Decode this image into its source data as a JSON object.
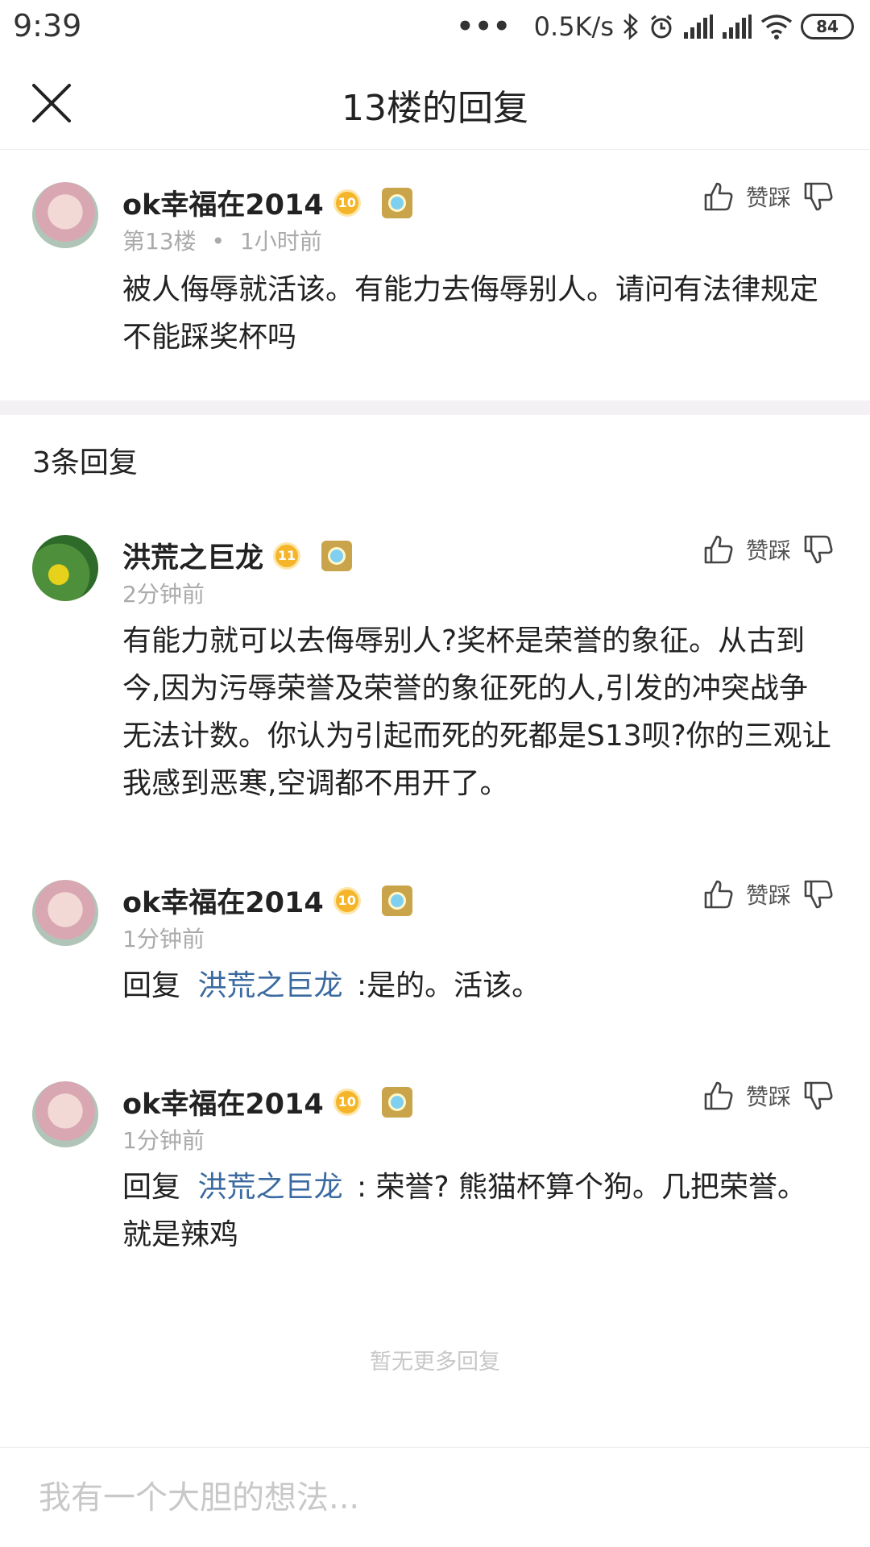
{
  "status_bar": {
    "time": "9:39",
    "dots": "•••",
    "speed": "0.5K/s",
    "battery": "84"
  },
  "header": {
    "title": "13楼的回复"
  },
  "post": {
    "username": "ok幸福在2014",
    "level": "10",
    "floor": "第13楼",
    "separator": "•",
    "time": "1小时前",
    "text": "被人侮辱就活该。有能力去侮辱别人。请问有法律规定不能踩奖杯吗",
    "vote_label": "赞踩"
  },
  "replies_header": {
    "count_label": "3条回复"
  },
  "replies": [
    {
      "username": "洪荒之巨龙",
      "level": "11",
      "time": "2分钟前",
      "text": "有能力就可以去侮辱别人?奖杯是荣誉的象征。从古到今,因为污辱荣誉及荣誉的象征死的人,引发的冲突战争无法计数。你认为引起而死的死都是S13呗?你的三观让我感到恶寒,空调都不用开了。",
      "vote_label": "赞踩"
    },
    {
      "username": "ok幸福在2014",
      "level": "10",
      "time": "1分钟前",
      "reply_prefix": "回复",
      "reply_to": "洪荒之巨龙",
      "text": " :是的。活该。",
      "vote_label": "赞踩"
    },
    {
      "username": "ok幸福在2014",
      "level": "10",
      "time": "1分钟前",
      "reply_prefix": "回复",
      "reply_to": "洪荒之巨龙",
      "text": " : 荣誉? 熊猫杯算个狗。几把荣誉。就是辣鸡",
      "vote_label": "赞踩"
    }
  ],
  "footer": {
    "no_more": "暂无更多回复",
    "input_placeholder": "我有一个大胆的想法..."
  }
}
